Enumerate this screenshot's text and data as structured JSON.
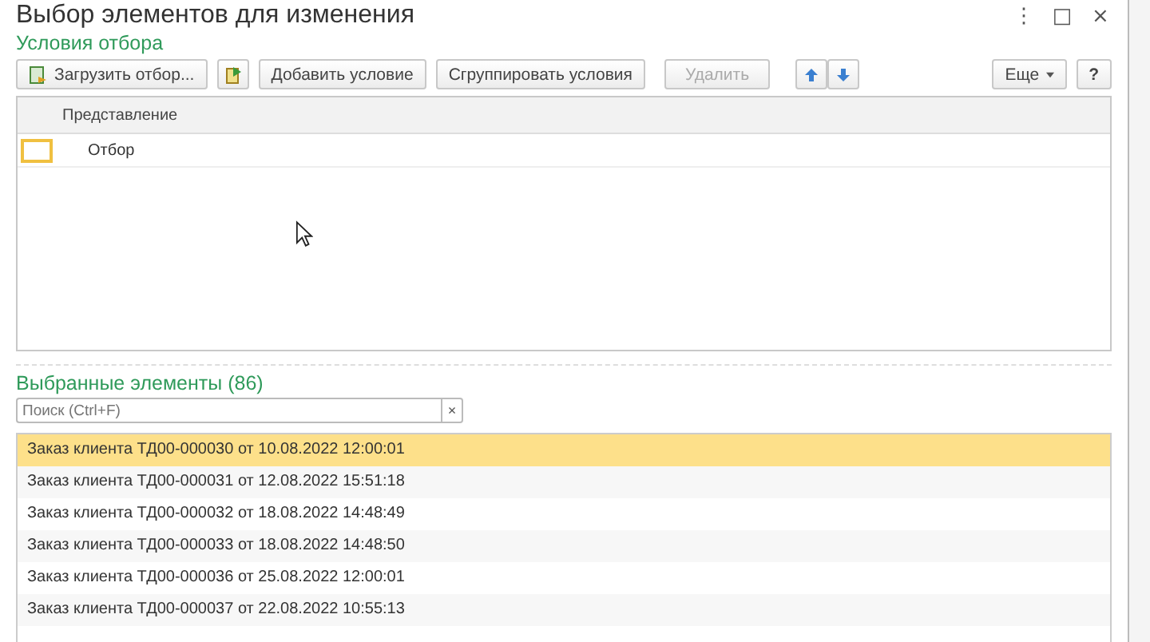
{
  "window": {
    "title": "Выбор элементов для изменения",
    "controls": [
      "⋮",
      "□",
      "×"
    ]
  },
  "filter_section": {
    "title": "Условия отбора"
  },
  "toolbar": [
    {
      "kind": "icon-text",
      "label": "Загрузить отбор...",
      "disabled": false
    },
    {
      "kind": "icon",
      "disabled": false
    },
    {
      "kind": "text",
      "label": "Добавить условие",
      "disabled": false
    },
    {
      "kind": "text",
      "label": "Сгруппировать условия",
      "disabled": false
    },
    {
      "kind": "text",
      "label": "Удалить",
      "disabled": true
    },
    {
      "kind": "updown",
      "disabled": false
    },
    {
      "kind": "menu",
      "label": "Еще",
      "disabled": false
    },
    {
      "kind": "help",
      "label": "?",
      "disabled": false
    }
  ],
  "filter_table": {
    "columns": [
      "Представление"
    ],
    "rows": [
      {
        "text": "Отбор",
        "selected": true
      }
    ]
  },
  "selected_section": {
    "title": "Выбранные элементы (86)",
    "search": {
      "placeholder": "Поиск (Ctrl+F)",
      "clear": "×"
    }
  },
  "items": [
    {
      "text": "Заказ клиента ТД00-000030 от 10.08.2022 12:00:01",
      "selected": true
    },
    {
      "text": "Заказ клиента ТД00-000031 от 12.08.2022 15:51:18",
      "selected": false
    },
    {
      "text": "Заказ клиента ТД00-000032 от 18.08.2022 14:48:49",
      "selected": false
    },
    {
      "text": "Заказ клиента ТД00-000033 от 18.08.2022 14:48:50",
      "selected": false
    },
    {
      "text": "Заказ клиента ТД00-000036 от 25.08.2022 12:00:01",
      "selected": false
    },
    {
      "text": "Заказ клиента ТД00-000037 от 22.08.2022 10:55:13",
      "selected": false
    }
  ]
}
